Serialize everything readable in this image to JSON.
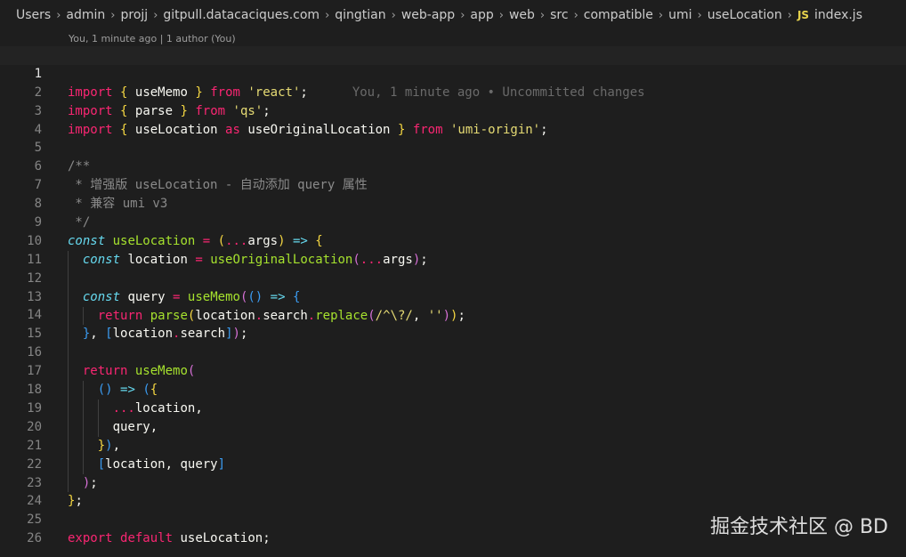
{
  "breadcrumb": {
    "items": [
      "Users",
      "admin",
      "projj",
      "gitpull.datacaciques.com",
      "qingtian",
      "web-app",
      "app",
      "web",
      "src",
      "compatible",
      "umi",
      "useLocation"
    ],
    "file_icon": "JS",
    "file_name": "index.js"
  },
  "blame_header": "You, 1 minute ago | 1 author (You)",
  "inline_blame": "You, 1 minute ago • Uncommitted changes",
  "line_numbers": [
    "1",
    "2",
    "3",
    "4",
    "5",
    "6",
    "7",
    "8",
    "9",
    "10",
    "11",
    "12",
    "13",
    "14",
    "15",
    "16",
    "17",
    "18",
    "19",
    "20",
    "21",
    "22",
    "23",
    "24",
    "25",
    "26"
  ],
  "code": {
    "l1": {
      "kw1": "import",
      "b1": "{",
      "id1": "useMemo",
      "b2": "}",
      "kw2": "from",
      "str": "'react'",
      "p": ";"
    },
    "l2": {
      "kw1": "import",
      "b1": "{",
      "id1": "parse",
      "b2": "}",
      "kw2": "from",
      "str": "'qs'",
      "p": ";"
    },
    "l3": {
      "kw1": "import",
      "b1": "{",
      "id1": "useLocation",
      "kw_as": "as",
      "id2": "useOriginalLocation",
      "b2": "}",
      "kw2": "from",
      "str": "'umi-origin'",
      "p": ";"
    },
    "l5": "/**",
    "l6": " * 增强版 useLocation - 自动添加 query 属性",
    "l7": " * 兼容 umi v3",
    "l8": " */",
    "l9": {
      "dec": "const",
      "fn": "useLocation",
      "op": "=",
      "p1": "(",
      "spread": "...",
      "args": "args",
      "p2": ")",
      "arrow": "=>",
      "b": "{"
    },
    "l10": {
      "dec": "const",
      "id": "location",
      "op": "=",
      "fn": "useOriginalLocation",
      "p1": "(",
      "spread": "...",
      "args": "args",
      "p2": ")",
      "p": ";"
    },
    "l12": {
      "dec": "const",
      "id": "query",
      "op": "=",
      "fn": "useMemo",
      "p1": "(",
      "p2": "()",
      "arrow": "=>",
      "b": "{"
    },
    "l13": {
      "kw": "return",
      "fn": "parse",
      "p1": "(",
      "obj": "location",
      "dot1": ".",
      "prop": "search",
      "dot2": ".",
      "fn2": "replace",
      "p2": "(",
      "regex": "/^\\?/",
      "comma": ",",
      "str": "''",
      "p3": ")",
      "p4": ")",
      "p": ";"
    },
    "l14": {
      "b": "}",
      "comma": ",",
      "br1": "[",
      "obj": "location",
      "dot": ".",
      "prop": "search",
      "br2": "]",
      "p1": ")",
      "p": ";"
    },
    "l16": {
      "kw": "return",
      "fn": "useMemo",
      "p1": "("
    },
    "l17": {
      "p": "()",
      "arrow": "=>",
      "p2": "(",
      "b": "{"
    },
    "l18": {
      "spread": "...",
      "id": "location",
      "comma": ","
    },
    "l19": {
      "id": "query",
      "comma": ","
    },
    "l20": {
      "b": "}",
      "p": ")",
      "comma": ","
    },
    "l21": {
      "br1": "[",
      "id1": "location",
      "comma": ",",
      "id2": "query",
      "br2": "]"
    },
    "l22": {
      "p": ")",
      "semi": ";"
    },
    "l23": {
      "b": "}",
      "semi": ";"
    },
    "l25": {
      "kw1": "export",
      "kw2": "default",
      "id": "useLocation",
      "semi": ";"
    }
  },
  "watermark": "掘金技术社区 @ BD"
}
